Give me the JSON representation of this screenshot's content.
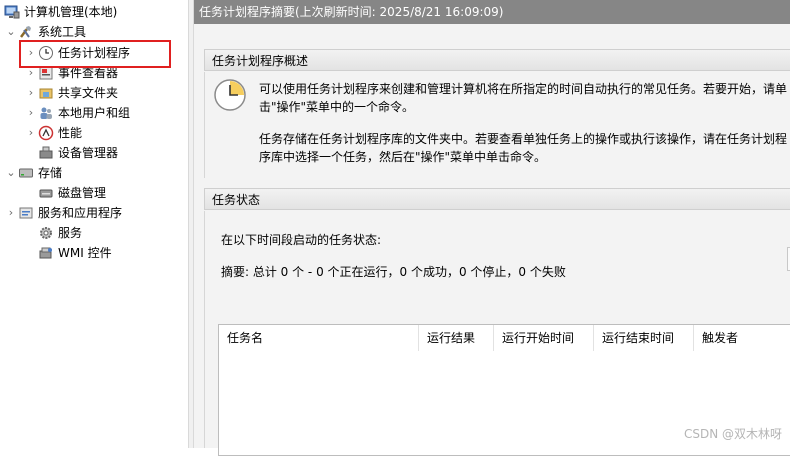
{
  "tree": {
    "root": "计算机管理(本地)",
    "system_tools": "系统工具",
    "task_scheduler": "任务计划程序",
    "event_viewer": "事件查看器",
    "shared_folders": "共享文件夹",
    "local_users": "本地用户和组",
    "performance": "性能",
    "device_manager": "设备管理器",
    "storage": "存储",
    "disk_management": "磁盘管理",
    "services_apps": "服务和应用程序",
    "services": "服务",
    "wmi_control": "WMI 控件"
  },
  "main": {
    "title": "任务计划程序摘要(上次刷新时间: 2025/8/21 16:09:09)",
    "overview_header": "任务计划程序概述",
    "overview_para1": "可以使用任务计划程序来创建和管理计算机将在所指定的时间自动执行的常见任务。若要开始，请单击\"操作\"菜单中的一个命令。",
    "overview_para2": "任务存储在任务计划程序库的文件夹中。若要查看单独任务上的操作或执行该操作，请在任务计划程序库中选择一个任务，然后在\"操作\"菜单中单击命令。",
    "status_header": "任务状态",
    "status_label": "在以下时间段启动的任务状态:",
    "summary": "摘要: 总计 0 个 - 0 个正在运行，0 个成功，0 个停止，0 个失败",
    "columns": [
      "任务名",
      "运行结果",
      "运行开始时间",
      "运行结束时间",
      "触发者"
    ]
  },
  "watermark": "CSDN @双木林呀"
}
